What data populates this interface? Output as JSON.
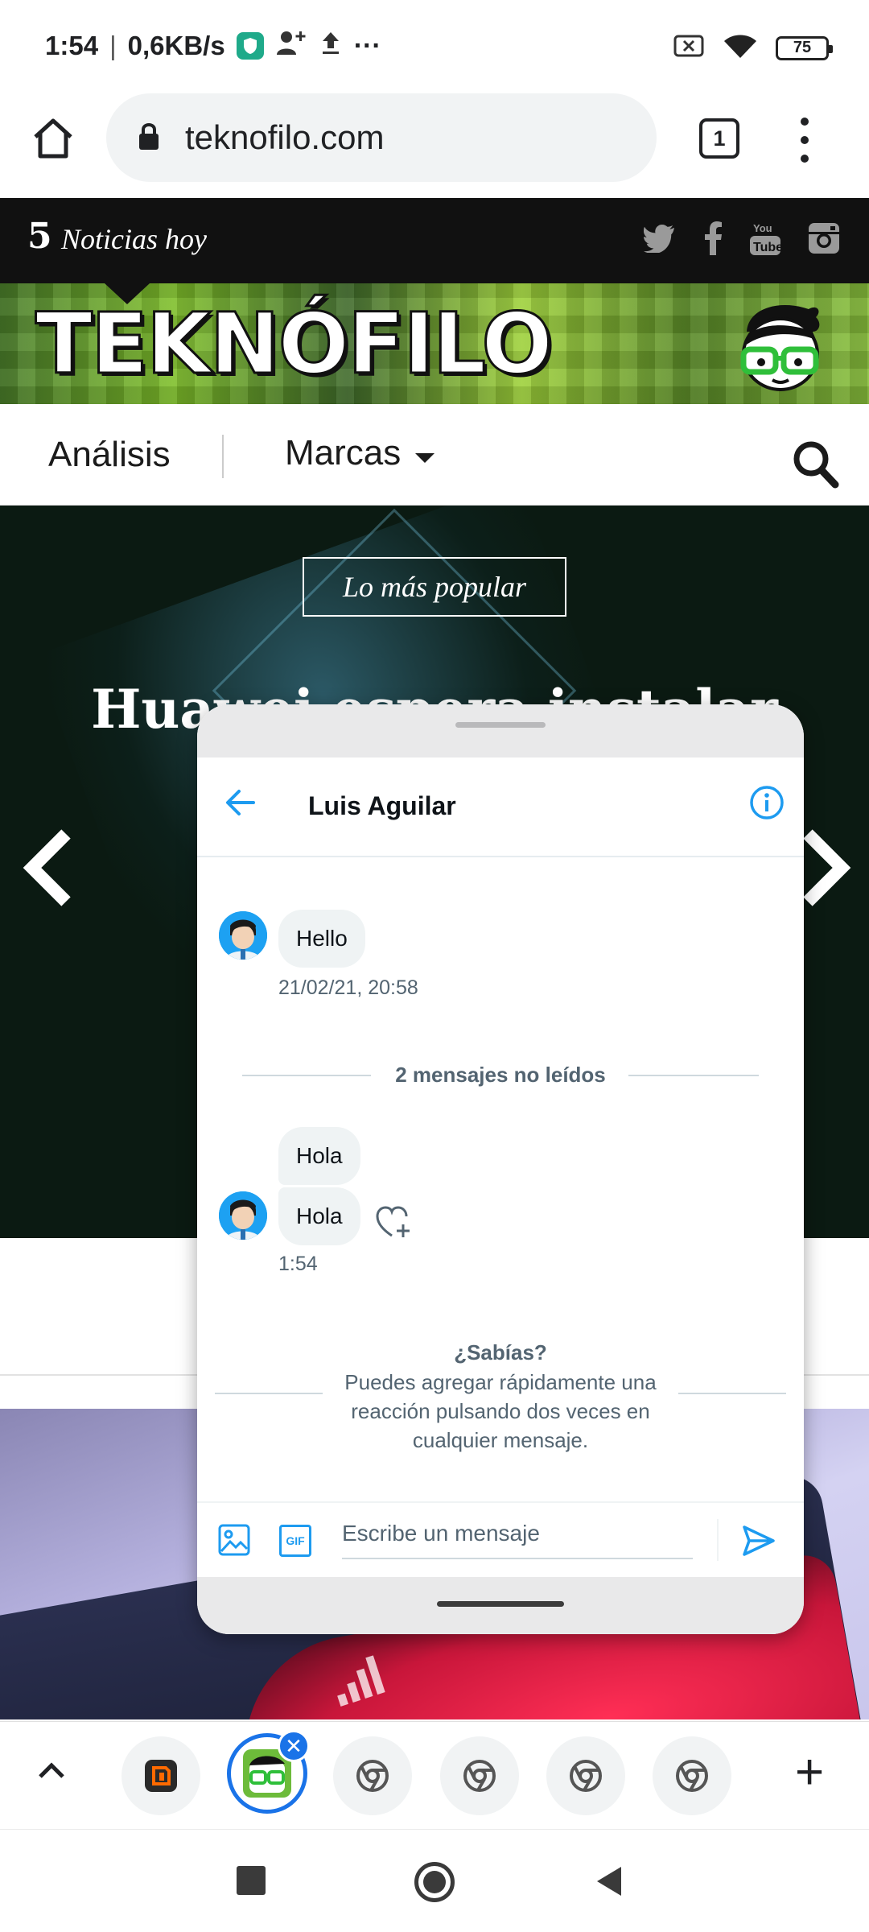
{
  "status_bar": {
    "time": "1:54",
    "speed": "0,6KB/s",
    "more": "···",
    "battery": "75",
    "icons": [
      "vpn-shield-icon",
      "add-contact-icon",
      "upload-icon",
      "sim-icon",
      "wifi-icon",
      "battery-icon"
    ]
  },
  "browser": {
    "url": "teknofilo.com",
    "tab_count": "1"
  },
  "site": {
    "news_count": "5",
    "news_label": "Noticias hoy",
    "logo": "TEKNÓFILO",
    "nav": {
      "analisis": "Análisis",
      "marcas": "Marcas"
    },
    "hero": {
      "tag": "Lo más popular",
      "headline": "Huawei espera instalar H... mil..."
    }
  },
  "chat": {
    "contact_name": "Luis Aguilar",
    "messages_first": [
      {
        "text": "Hello"
      }
    ],
    "time_first": "21/02/21, 20:58",
    "unread_divider": "2 mensajes no leídos",
    "messages_second": [
      {
        "text": "Hola"
      },
      {
        "text": "Hola"
      }
    ],
    "time_second": "1:54",
    "tip_title": "¿Sabías?",
    "tip_body": "Puedes agregar rápidamente una reacción pulsando dos veces en cualquier mensaje.",
    "composer_placeholder": "Escribe un mensaje",
    "gif_label": "GIF"
  },
  "dock": {
    "close_label": "✕",
    "add_label": "+"
  },
  "colors": {
    "twitter_blue": "#1d9bf0",
    "chrome_blue": "#1a73e8",
    "header_black": "#111111"
  }
}
